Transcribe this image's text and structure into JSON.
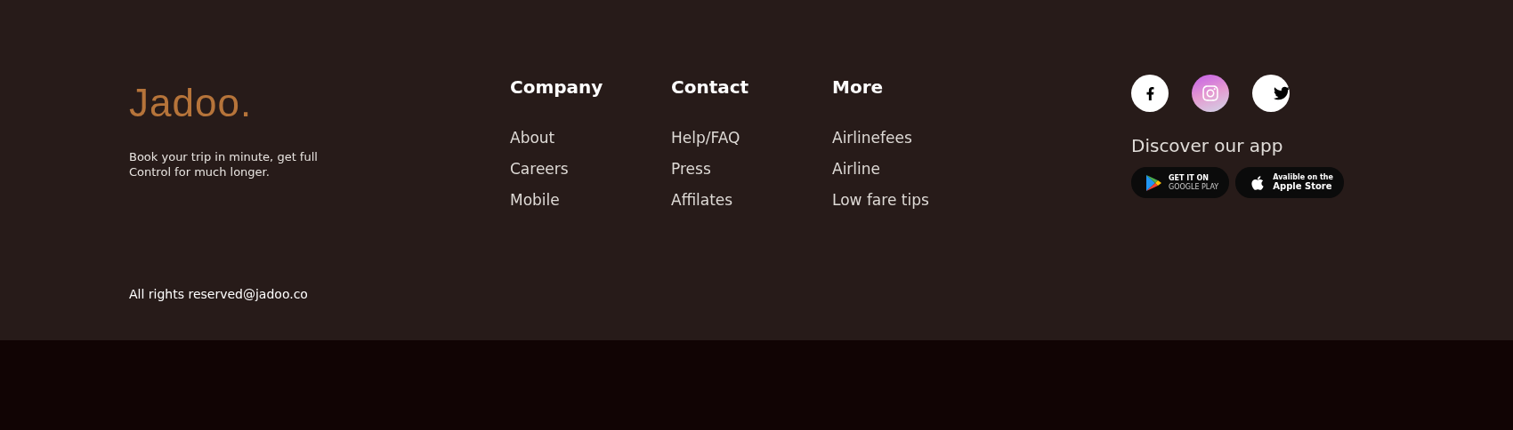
{
  "brand": {
    "logo": "Jadoo.",
    "tagline": "Book your trip in minute, get full Control for much longer.",
    "copyright": "All rights reserved@jadoo.co"
  },
  "columns": [
    {
      "heading": "Company",
      "links": [
        "About",
        "Careers",
        "Mobile"
      ]
    },
    {
      "heading": "Contact",
      "links": [
        "Help/FAQ",
        "Press",
        "Affilates"
      ]
    },
    {
      "heading": "More",
      "links": [
        "Airlinefees",
        "Airline",
        "Low fare tips"
      ]
    }
  ],
  "social": [
    {
      "kind": "facebook"
    },
    {
      "kind": "instagram"
    },
    {
      "kind": "twitter"
    }
  ],
  "app": {
    "title": "Discover our app",
    "stores": [
      {
        "kind": "google",
        "line_1": "GET IT ON",
        "line_2": "GOOGLE PLAY"
      },
      {
        "kind": "apple",
        "line_1": "Avalible on the",
        "line_2": "Apple Store"
      }
    ]
  }
}
